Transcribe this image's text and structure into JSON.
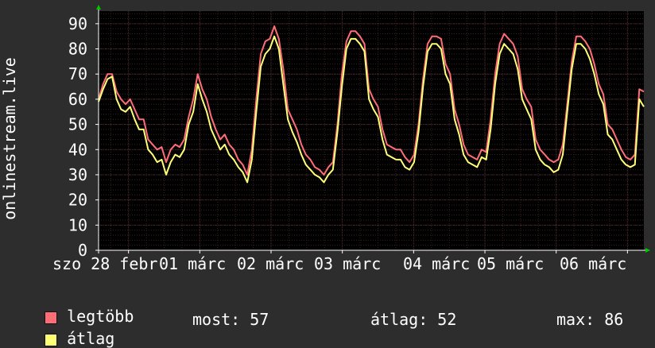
{
  "chart_data": {
    "type": "line",
    "ylabel": "onlinestream.live",
    "ylim": [
      0,
      95
    ],
    "yticks": [
      0,
      10,
      20,
      30,
      40,
      50,
      60,
      70,
      80,
      90
    ],
    "xtick_labels": [
      "szo 28 febr",
      "01 márc",
      "02 márc",
      "03 márc",
      "04 márc",
      "05 márc",
      "06 márc"
    ],
    "x_span_days": 7.65,
    "grid": true,
    "colors": {
      "max": "#ff6e78",
      "avg": "#ffff78",
      "background": "#000000",
      "grid_major": "#5a3232",
      "axis_arrow": "#00c800"
    },
    "series": [
      {
        "name": "legtöbb",
        "key": "max",
        "values": [
          60,
          66,
          70,
          70,
          63,
          60,
          58,
          60,
          56,
          52,
          52,
          44,
          42,
          40,
          41,
          35,
          40,
          42,
          41,
          44,
          53,
          60,
          70,
          64,
          60,
          53,
          48,
          44,
          46,
          42,
          40,
          36,
          34,
          30,
          40,
          60,
          78,
          83,
          84,
          89,
          84,
          72,
          56,
          52,
          48,
          42,
          38,
          36,
          33,
          32,
          30,
          33,
          35,
          50,
          70,
          83,
          87,
          87,
          85,
          82,
          64,
          60,
          57,
          48,
          42,
          41,
          40,
          40,
          37,
          35,
          38,
          50,
          68,
          82,
          85,
          85,
          84,
          74,
          70,
          56,
          50,
          42,
          38,
          37,
          36,
          40,
          39,
          52,
          70,
          82,
          86,
          84,
          82,
          77,
          64,
          60,
          57,
          44,
          40,
          38,
          36,
          35,
          36,
          42,
          58,
          75,
          85,
          85,
          83,
          80,
          74,
          66,
          62,
          50,
          48,
          44,
          40,
          37,
          36,
          38,
          64,
          63
        ]
      },
      {
        "name": "átlag",
        "key": "avg",
        "values": [
          59,
          64,
          68,
          69,
          60,
          56,
          55,
          57,
          52,
          48,
          48,
          40,
          38,
          35,
          36,
          30,
          35,
          38,
          37,
          40,
          50,
          55,
          66,
          60,
          55,
          48,
          44,
          40,
          42,
          38,
          36,
          33,
          31,
          27,
          36,
          55,
          73,
          78,
          80,
          85,
          80,
          66,
          52,
          47,
          43,
          38,
          34,
          32,
          30,
          29,
          27,
          30,
          32,
          47,
          65,
          80,
          84,
          84,
          82,
          79,
          60,
          56,
          53,
          44,
          38,
          37,
          36,
          36,
          33,
          32,
          35,
          47,
          65,
          79,
          82,
          82,
          80,
          70,
          66,
          52,
          46,
          38,
          35,
          34,
          33,
          37,
          36,
          48,
          66,
          78,
          82,
          80,
          78,
          72,
          60,
          56,
          52,
          40,
          36,
          34,
          33,
          31,
          32,
          38,
          55,
          72,
          82,
          82,
          80,
          76,
          70,
          62,
          58,
          46,
          44,
          40,
          36,
          34,
          33,
          34,
          60,
          57
        ]
      }
    ]
  },
  "legend": {
    "items": [
      {
        "label": "legtöbb",
        "color": "#ff6e78"
      },
      {
        "label": "átlag",
        "color": "#ffff78"
      }
    ]
  },
  "stats": {
    "most": "most: 57",
    "atlag": "átlag: 52",
    "max": "max: 86"
  }
}
